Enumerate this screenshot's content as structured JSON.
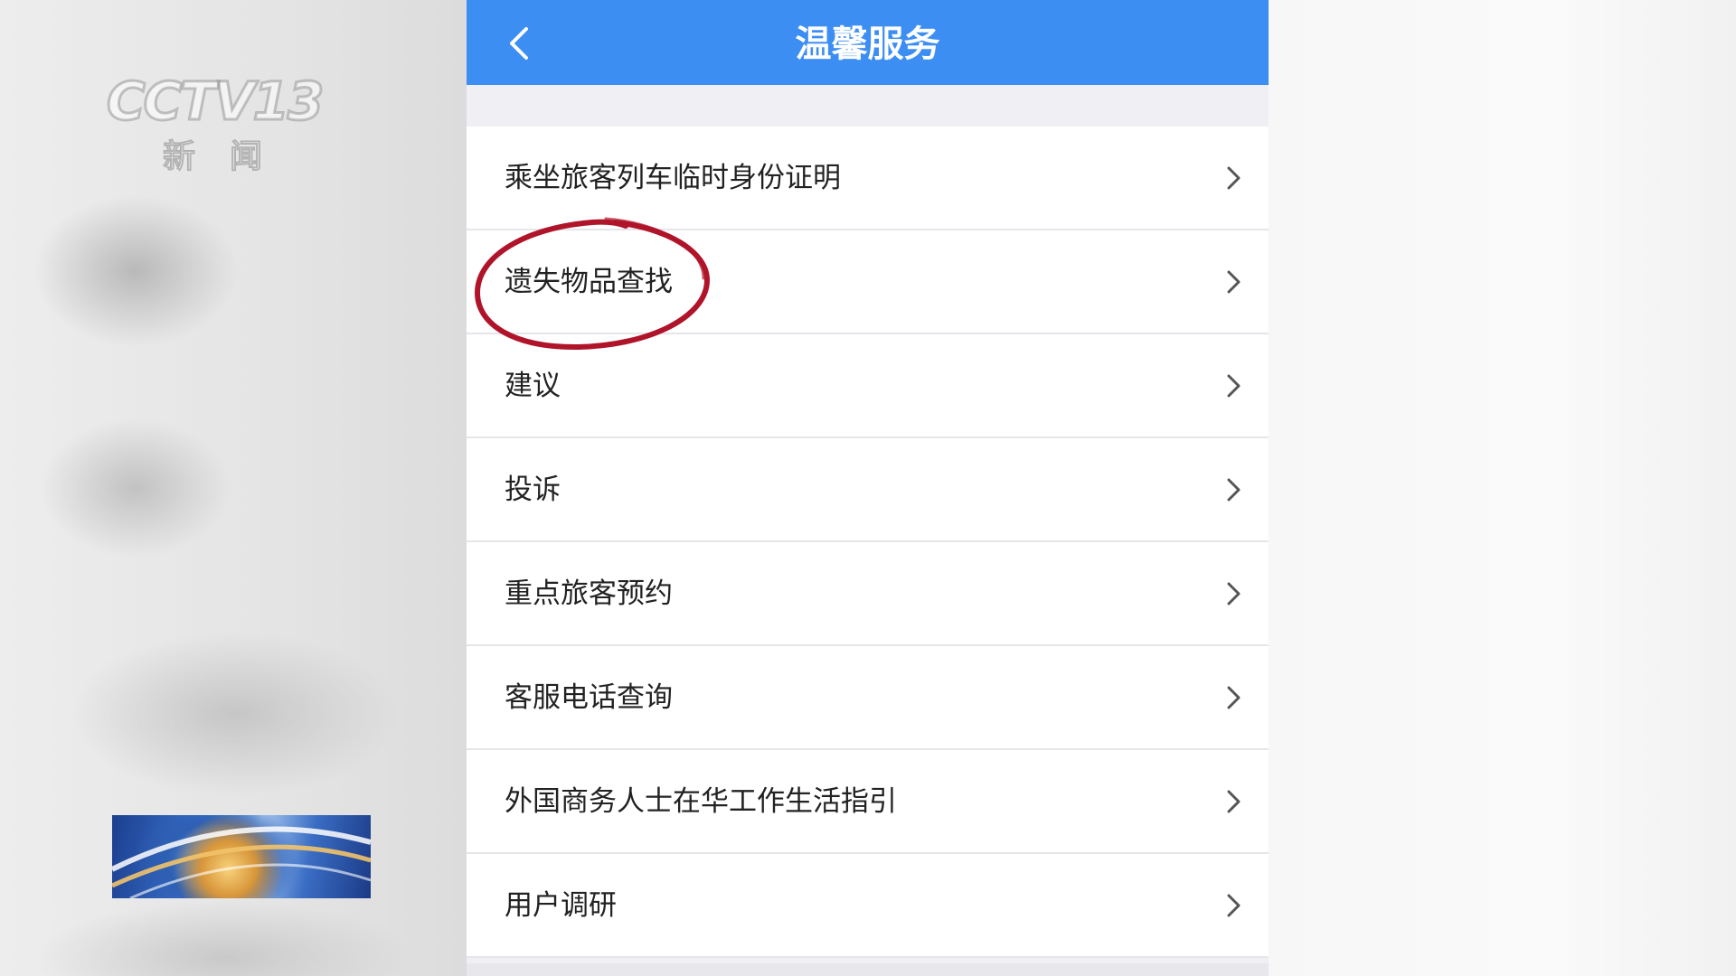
{
  "broadcast": {
    "logo_text": "CCTV13",
    "channel_text": "新闻"
  },
  "nav": {
    "title": "温馨服务",
    "back_icon": "chevron-left-icon"
  },
  "menu": {
    "items": [
      {
        "label": "乘坐旅客列车临时身份证明"
      },
      {
        "label": "遗失物品查找"
      },
      {
        "label": "建议"
      },
      {
        "label": "投诉"
      },
      {
        "label": "重点旅客预约"
      },
      {
        "label": "客服电话查询"
      },
      {
        "label": "外国商务人士在华工作生活指引"
      },
      {
        "label": "用户调研"
      }
    ],
    "chevron_icon": "chevron-right-icon"
  },
  "colors": {
    "nav_background": "#3d8ef3",
    "annotation_circle": "#b0142a"
  }
}
